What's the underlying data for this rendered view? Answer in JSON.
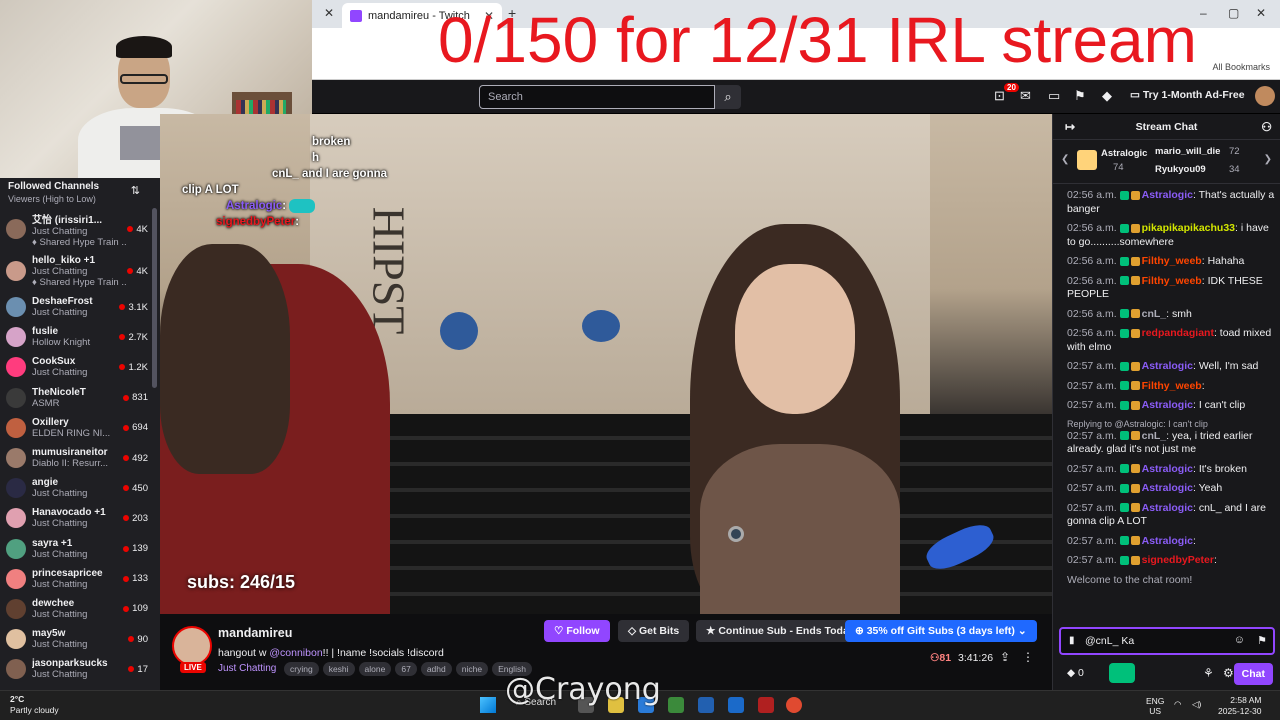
{
  "overlay": {
    "title": "0/150 for 12/31 IRL stream",
    "subs": "subs: 246/15",
    "chat": [
      {
        "text": "broken"
      },
      {
        "text": "h"
      },
      {
        "user": "cnL_",
        "text": " and I are gonna"
      },
      {
        "text": "clip A LOT"
      },
      {
        "user": "Astralogic",
        "text": ":"
      },
      {
        "user": "signedbyPeter",
        "text": ":"
      }
    ]
  },
  "browser": {
    "tab_title": "mandamireu - Twitch",
    "bookmarks": "All Bookmarks"
  },
  "nav": {
    "search_placeholder": "Search",
    "notif_count": "20",
    "adfree": "Try 1-Month Ad-Free"
  },
  "sidebar": {
    "title": "Followed Channels",
    "subtitle": "Viewers (High to Low)",
    "channels": [
      {
        "name": "艾怡 (irissiri1...",
        "cat": "Just Chatting",
        "hype": "Shared Hype Train ...",
        "count": "4K",
        "color": "#8a6a5a"
      },
      {
        "name": "hello_kiko +1",
        "cat": "Just Chatting",
        "hype": "Shared Hype Train ...",
        "count": "4K",
        "color": "#c99a8a"
      },
      {
        "name": "DeshaeFrost",
        "cat": "Just Chatting",
        "count": "3.1K",
        "color": "#6b8fb0"
      },
      {
        "name": "fuslie",
        "cat": "Hollow Knight",
        "count": "2.7K",
        "color": "#d6a3c8"
      },
      {
        "name": "CookSux",
        "cat": "Just Chatting",
        "count": "1.2K",
        "color": "#ff3c7e"
      },
      {
        "name": "TheNicoleT",
        "cat": "ASMR",
        "count": "831",
        "color": "#3a3a3a"
      },
      {
        "name": "Oxillery",
        "cat": "ELDEN RING NI...",
        "count": "694",
        "color": "#c06040"
      },
      {
        "name": "mumusiraneitor",
        "cat": "Diablo II: Resurr...",
        "count": "492",
        "color": "#9a7a6a"
      },
      {
        "name": "angie",
        "cat": "Just Chatting",
        "count": "450",
        "color": "#2a2a44"
      },
      {
        "name": "Hanavocado +1",
        "cat": "Just Chatting",
        "count": "203",
        "color": "#e0a0b0"
      },
      {
        "name": "sayra +1",
        "cat": "Just Chatting",
        "count": "139",
        "color": "#50a080"
      },
      {
        "name": "princesapricee",
        "cat": "Just Chatting",
        "count": "133",
        "color": "#f08080"
      },
      {
        "name": "dewchee",
        "cat": "Just Chatting",
        "count": "109",
        "color": "#604030"
      },
      {
        "name": "may5w",
        "cat": "Just Chatting",
        "count": "90",
        "color": "#e0c0a0"
      },
      {
        "name": "jasonparksucks",
        "cat": "Just Chatting",
        "count": "17",
        "color": "#806050"
      }
    ]
  },
  "stream": {
    "name": "mandamireu",
    "live": "LIVE",
    "title_pre": "hangout w ",
    "title_mention": "@connibon",
    "title_post": "!! | !name !socials !discord",
    "category": "Just Chatting",
    "tags": [
      "crying",
      "keshi",
      "alone",
      "67",
      "adhd",
      "niche",
      "English"
    ],
    "follow": "Follow",
    "bits": "Get Bits",
    "continue_sub": "Continue Sub - Ends Today",
    "gift": "35% off Gift Subs (3 days left)",
    "viewers": "81",
    "uptime": "3:41:26"
  },
  "chat": {
    "header": "Stream Chat",
    "leaderboard": {
      "first_name": "Astralogic",
      "first_count": "74",
      "second_name": "mario_will_die",
      "second_count": "72",
      "third_name": "Ryukyou09",
      "third_count": "34"
    },
    "messages": [
      {
        "ts": "02:56 a.m.",
        "user": "Astralogic",
        "color": "#8a5cf6",
        "text": ": That's actually a banger"
      },
      {
        "ts": "02:56 a.m.",
        "user": "pikapikapikachu33",
        "color": "#d3e600",
        "text": ": i have to go..........somewhere"
      },
      {
        "ts": "02:56 a.m.",
        "user": "Filthy_weeb",
        "color": "#ff4500",
        "text": ": Hahaha"
      },
      {
        "ts": "02:56 a.m.",
        "user": "Filthy_weeb",
        "color": "#ff4500",
        "text": ": IDK THESE PEOPLE"
      },
      {
        "ts": "02:56 a.m.",
        "user": "cnL_",
        "color": "#adadb8",
        "text": ": smh"
      },
      {
        "ts": "02:56 a.m.",
        "user": "redpandagiant",
        "color": "#e8181f",
        "text": ": toad mixed with elmo"
      },
      {
        "ts": "02:57 a.m.",
        "user": "Astralogic",
        "color": "#8a5cf6",
        "text": ": Well, I'm sad"
      },
      {
        "ts": "02:57 a.m.",
        "user": "Filthy_weeb",
        "color": "#ff4500",
        "text": ":"
      },
      {
        "ts": "02:57 a.m.",
        "user": "Astralogic",
        "color": "#8a5cf6",
        "text": ": I can't clip"
      },
      {
        "reply": "Replying to @Astralogic: I can't clip",
        "ts": "02:57 a.m.",
        "user": "cnL_",
        "color": "#adadb8",
        "text": ": yea, i tried earlier already. glad it's not just me"
      },
      {
        "ts": "02:57 a.m.",
        "user": "Astralogic",
        "color": "#8a5cf6",
        "text": ": It's broken"
      },
      {
        "ts": "02:57 a.m.",
        "user": "Astralogic",
        "color": "#8a5cf6",
        "text": ": Yeah"
      },
      {
        "ts": "02:57 a.m.",
        "user": "Astralogic",
        "color": "#8a5cf6",
        "text": ": cnL_ and I are gonna clip A LOT"
      },
      {
        "ts": "02:57 a.m.",
        "user": "Astralogic",
        "color": "#8a5cf6",
        "text": ":"
      },
      {
        "ts": "02:57 a.m.",
        "user": "signedbyPeter",
        "color": "#e8181f",
        "text": ":"
      }
    ],
    "welcome": "Welcome to the chat room!",
    "input_value": "@cnL_ Ka",
    "bits_count": "0",
    "chat_button": "Chat"
  },
  "taskbar": {
    "temp": "2°C",
    "weather": "Partly cloudy",
    "search": "Search",
    "lang1": "ENG",
    "lang2": "US",
    "time": "2:58 AM",
    "date": "2025-12-30",
    "watermark": "@Crayong"
  },
  "colors": {
    "twitch_purple": "#9146ff",
    "live_red": "#eb0400",
    "overlay_red": "#e8181f",
    "gift_blue": "#1f69ff"
  }
}
